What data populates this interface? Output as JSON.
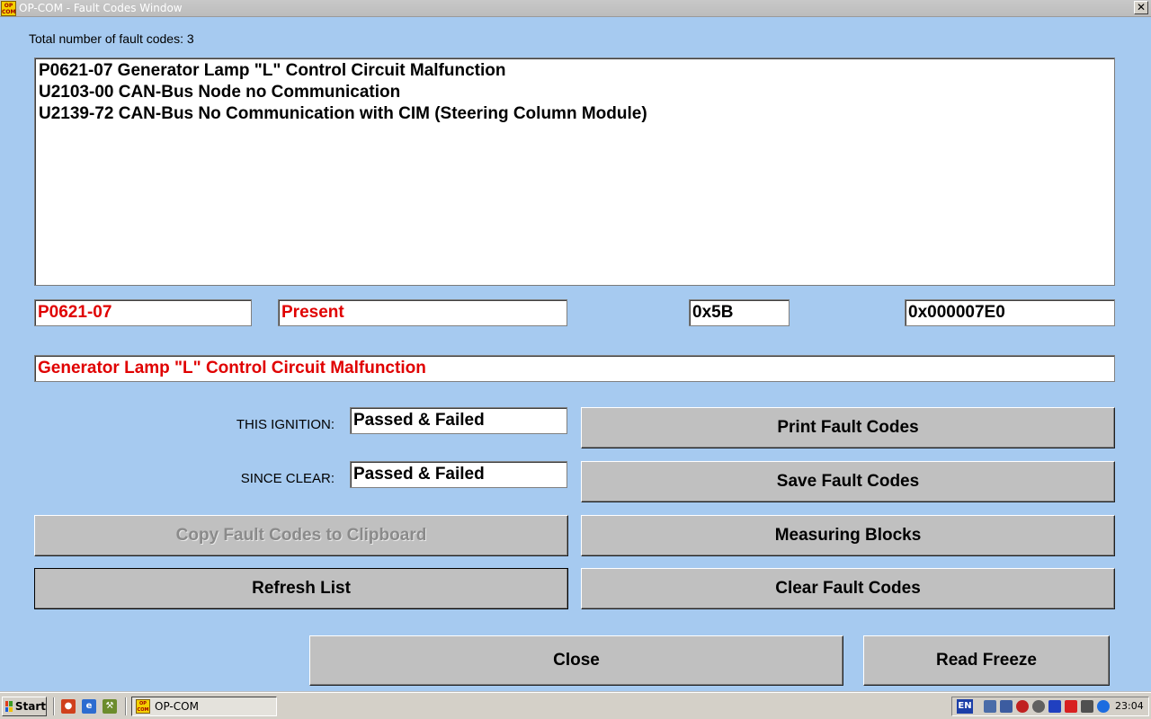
{
  "window": {
    "title": "OP-COM - Fault Codes Window",
    "icon_text": "OP COM",
    "close_glyph": "✕"
  },
  "summary": {
    "total_label": "Total number of fault codes:  3"
  },
  "fault_list": [
    "P0621-07 Generator Lamp \"L\" Control Circuit Malfunction",
    "U2103-00 CAN-Bus Node no Communication",
    "U2139-72 CAN-Bus No Communication with CIM (Steering Column Module)"
  ],
  "selected": {
    "code": "P0621-07",
    "state": "Present",
    "byte": "0x5B",
    "address": "0x000007E0",
    "description": "Generator Lamp \"L\" Control Circuit Malfunction"
  },
  "status": {
    "this_ignition_label": "THIS IGNITION:",
    "this_ignition_value": "Passed & Failed",
    "since_clear_label": "SINCE CLEAR:",
    "since_clear_value": "Passed & Failed"
  },
  "buttons": {
    "print": "Print Fault Codes",
    "save": "Save Fault Codes",
    "copy": "Copy Fault Codes to Clipboard",
    "measuring": "Measuring Blocks",
    "refresh": "Refresh List",
    "clear": "Clear Fault Codes",
    "close": "Close",
    "freeze": "Read Freeze"
  },
  "taskbar": {
    "start_label": "Start",
    "task_label": "OP-COM",
    "lang": "EN",
    "clock": "23:04",
    "quick_launch_icons": [
      "media-player-icon",
      "browser-icon",
      "tools-icon"
    ],
    "tray_icons": [
      "network-icon",
      "network-icon",
      "shield-icon",
      "volume-icon",
      "battery-icon",
      "antivirus-icon",
      "display-icon",
      "bluetooth-icon"
    ]
  },
  "colors": {
    "background": "#a6caf0",
    "highlight_text": "#e00000"
  }
}
